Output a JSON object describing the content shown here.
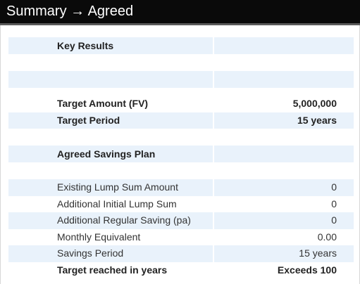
{
  "window": {
    "title": "Summary → Agreed"
  },
  "key_results": {
    "heading": "Key Results",
    "rows": [
      {
        "label": "Target Amount (FV)",
        "value": "5,000,000"
      },
      {
        "label": "Target Period",
        "value": "15 years"
      }
    ]
  },
  "savings_plan": {
    "heading": "Agreed Savings Plan",
    "rows": [
      {
        "label": "Existing Lump Sum Amount",
        "value": "0"
      },
      {
        "label": "Additional Initial Lump Sum",
        "value": "0"
      },
      {
        "label": "Additional Regular Saving (pa)",
        "value": "0"
      },
      {
        "label": "Monthly Equivalent",
        "value": "0.00"
      },
      {
        "label": "Savings Period",
        "value": "15 years"
      },
      {
        "label": "Target reached in years",
        "value": "Exceeds 100"
      }
    ]
  },
  "colors": {
    "titlebar": "#0a0a0a",
    "row_shade": "#e9f2fb"
  }
}
